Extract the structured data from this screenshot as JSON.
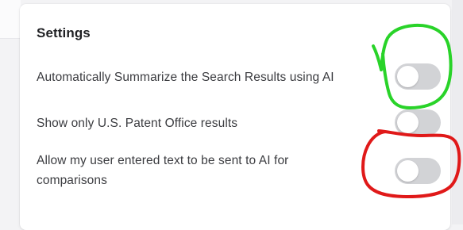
{
  "settings": {
    "title": "Settings",
    "rows": [
      {
        "label": "Automatically Summarize the Search Results using AI",
        "enabled": false
      },
      {
        "label": "Show only U.S. Patent Office results",
        "enabled": false
      },
      {
        "label": "Allow my user entered text to be sent to AI for comparisons",
        "enabled": false
      }
    ]
  },
  "annotations": {
    "green_mark_color": "#29d329",
    "red_mark_color": "#e01919"
  }
}
